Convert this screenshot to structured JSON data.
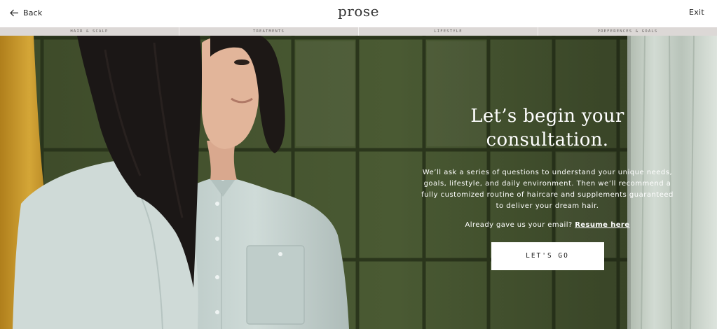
{
  "header": {
    "back_label": "Back",
    "logo": "prose",
    "exit_label": "Exit"
  },
  "steps": [
    "HAIR & SCALP",
    "TREATMENTS",
    "LIFESTYLE",
    "PREFERENCES & GOALS"
  ],
  "hero": {
    "title_line1": "Let’s begin your",
    "title_line2": "consultation.",
    "description": "We’ll ask a series of questions to understand your unique needs, goals, lifestyle, and daily environment. Then we’ll recommend a fully customized routine of haircare and supplements guaranteed to deliver your dream hair.",
    "already_text": "Already gave us your email?",
    "resume_link": "Resume here",
    "cta_label": "LET'S GO"
  },
  "colors": {
    "tile_green": "#45552f",
    "grout": "#2b3520",
    "shirt_mint": "#c8d5d2",
    "towel_yellow": "#c4962a",
    "hair_black": "#1b1716"
  }
}
